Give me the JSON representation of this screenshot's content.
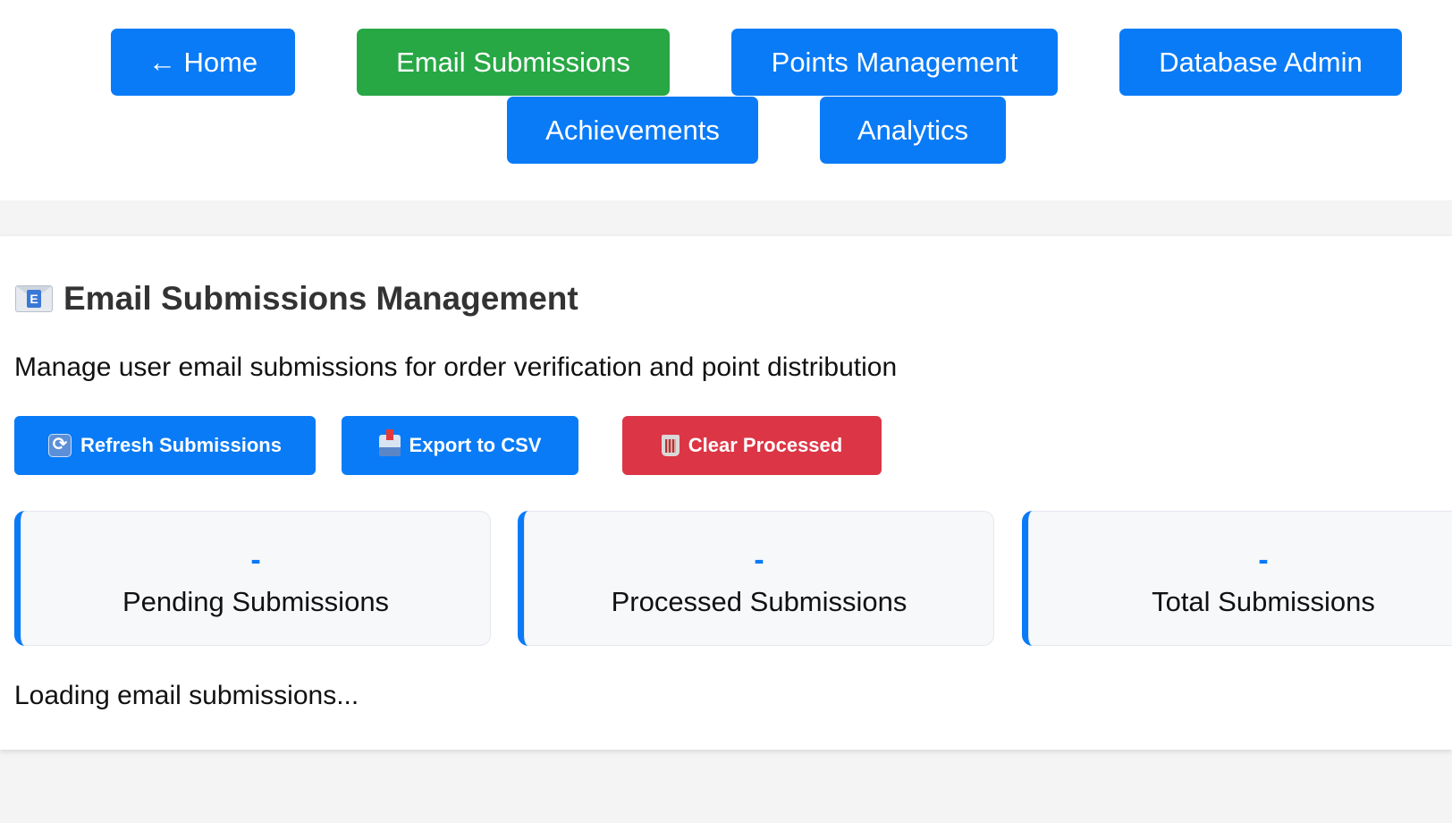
{
  "nav": {
    "home": "← Home",
    "email_submissions": "Email Submissions",
    "points_management": "Points Management",
    "database_admin": "Database Admin",
    "achievements": "Achievements",
    "analytics": "Analytics"
  },
  "header": {
    "icon": "envelope-icon",
    "title": "Email Submissions Management",
    "subtitle": "Manage user email submissions for order verification and point distribution"
  },
  "actions": {
    "refresh": "Refresh Submissions",
    "export": "Export to CSV",
    "clear": "Clear Processed"
  },
  "stats": [
    {
      "value": "-",
      "label": "Pending Submissions"
    },
    {
      "value": "-",
      "label": "Processed Submissions"
    },
    {
      "value": "-",
      "label": "Total Submissions"
    }
  ],
  "status": {
    "loading": "Loading email submissions..."
  },
  "colors": {
    "primary": "#0a7bf7",
    "active": "#28a745",
    "danger": "#dc3545"
  }
}
